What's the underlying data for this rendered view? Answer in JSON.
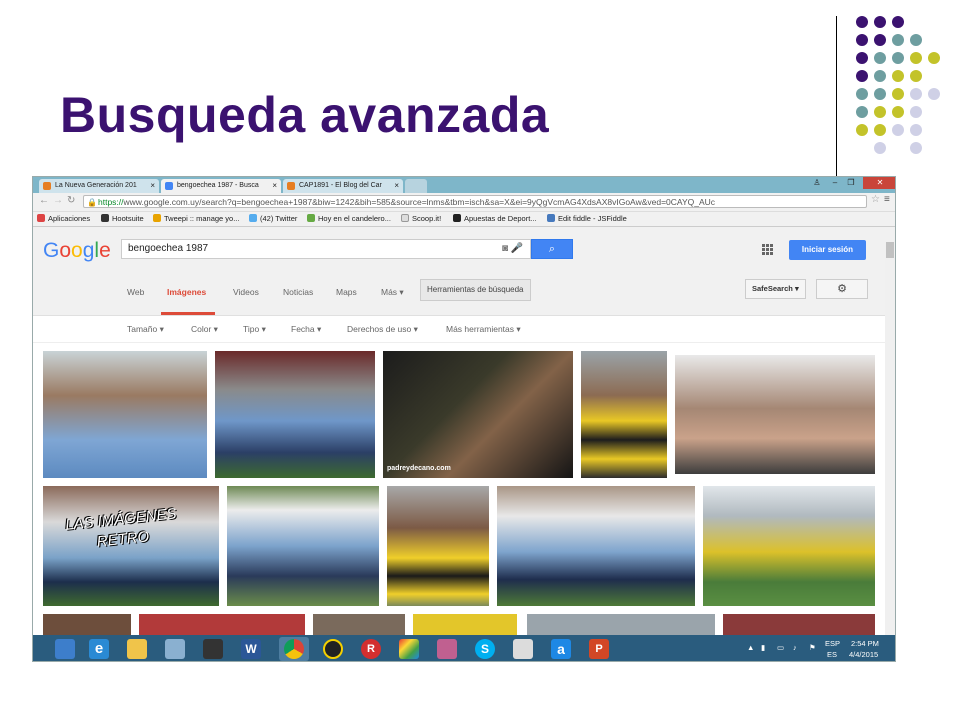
{
  "slide": {
    "title": "Busqueda avanzada",
    "colors": {
      "title": "#3b1270",
      "dot_purple": "#3b1270",
      "dot_teal": "#6e9ea0",
      "dot_yellow": "#c3c32a",
      "dot_lavender": "#cfd0e6"
    }
  },
  "browser": {
    "tabs": [
      {
        "label": "La Nueva Generación 201",
        "favicon": "blogger-icon"
      },
      {
        "label": "bengoechea 1987 - Busca",
        "favicon": "google-icon",
        "active": true
      },
      {
        "label": "CAP1891 - El Blog del Car",
        "favicon": "blogger-icon"
      }
    ],
    "url_scheme": "https://",
    "url_rest": "www.google.com.uy/search?q=bengoechea+1987&biw=1242&bih=585&source=lnms&tbm=isch&sa=X&ei=9yQgVcmAG4XdsAX8vIGoAw&ved=0CAYQ_AUc",
    "bookmarks": [
      {
        "label": "Aplicaciones",
        "icon": "apps-icon"
      },
      {
        "label": "Hootsuite",
        "icon": "owl-icon"
      },
      {
        "label": "Tweepi :: manage yo...",
        "icon": "tweepi-icon"
      },
      {
        "label": "(42) Twitter",
        "icon": "twitter-icon"
      },
      {
        "label": "Hoy en el candelero...",
        "icon": "bookmark-icon"
      },
      {
        "label": "Scoop.it!",
        "icon": "page-icon"
      },
      {
        "label": "Apuestas de Deport...",
        "icon": "betting-icon"
      },
      {
        "label": "Edit fiddle - JSFiddle",
        "icon": "fiddle-icon"
      }
    ]
  },
  "google": {
    "logo": "Google",
    "query": "bengoechea 1987",
    "signin": "Iniciar sesión",
    "nav": [
      "Web",
      "Imágenes",
      "Videos",
      "Noticias",
      "Maps",
      "Más ▾"
    ],
    "tools": "Herramientas de búsqueda",
    "safesearch": "SafeSearch ▾",
    "filters": [
      "Tamaño ▾",
      "Color ▾",
      "Tipo ▾",
      "Fecha ▾",
      "Derechos de uso ▾",
      "Más herramientas ▾"
    ],
    "image_captions": {
      "padreydecano": "padreydecano.com",
      "watermark": "LAS IMÁGENES RETRO"
    }
  },
  "taskbar": {
    "lang_top": "ESP",
    "lang_bottom": "ES",
    "time": "2:54 PM",
    "date": "4/4/2015"
  }
}
